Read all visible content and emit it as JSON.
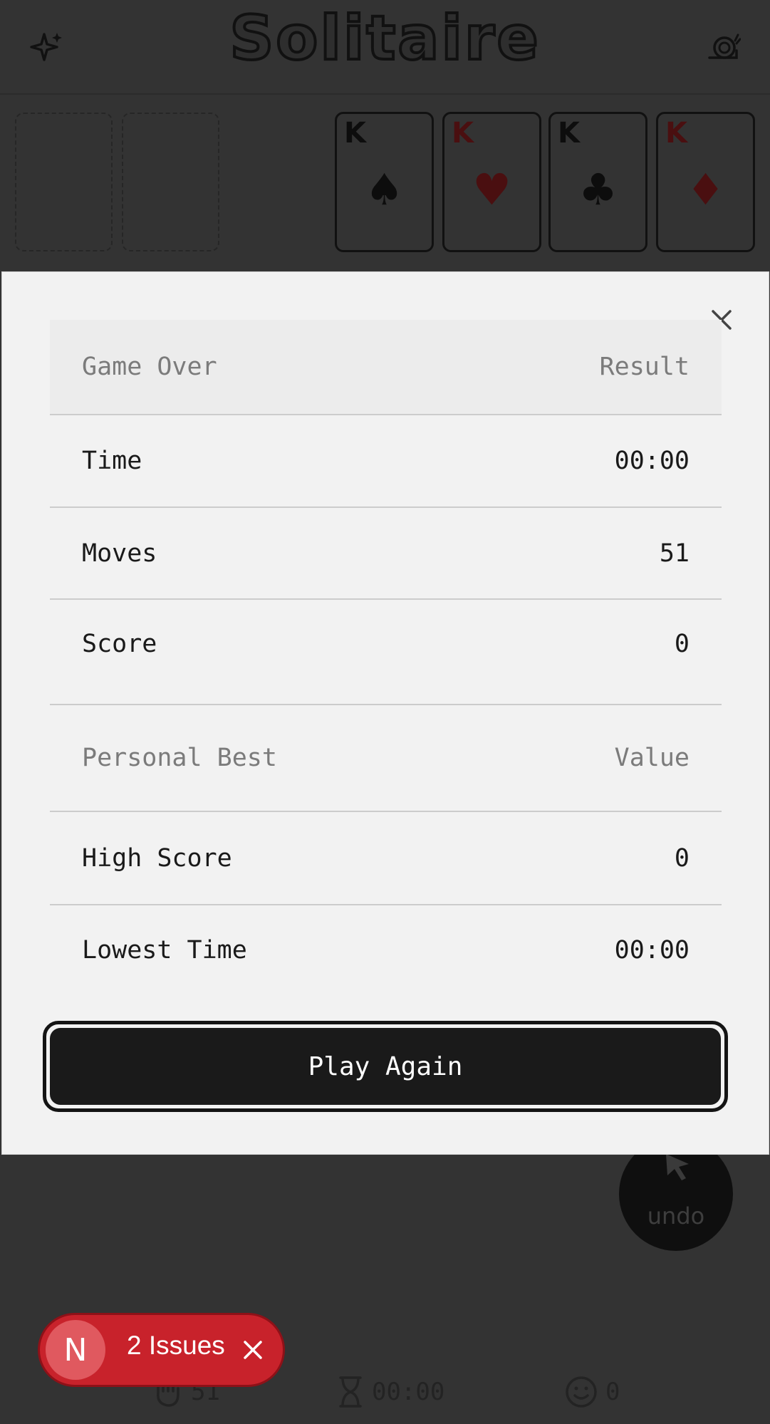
{
  "header": {
    "title": "Solitaire",
    "left_icon": "sparkle-icon",
    "right_icon": "snail-icon"
  },
  "foundations": [
    {
      "rank": "K",
      "suit": "♠",
      "color": "black"
    },
    {
      "rank": "K",
      "suit": "♥",
      "color": "red"
    },
    {
      "rank": "K",
      "suit": "♣",
      "color": "black"
    },
    {
      "rank": "K",
      "suit": "♦",
      "color": "red"
    }
  ],
  "modal": {
    "close_icon": "close-icon",
    "game_over": {
      "header_label": "Game Over",
      "header_value": "Result"
    },
    "stats": [
      {
        "label": "Time",
        "value": "00:00"
      },
      {
        "label": "Moves",
        "value": "51"
      },
      {
        "label": "Score",
        "value": "0"
      }
    ],
    "personal_best": {
      "header_label": "Personal Best",
      "header_value": "Value"
    },
    "best": [
      {
        "label": "High Score",
        "value": "0"
      },
      {
        "label": "Lowest Time",
        "value": "00:00"
      }
    ],
    "play_again_label": "Play Again"
  },
  "undo": {
    "label": "undo",
    "icon": "cursor-icon"
  },
  "footer": {
    "moves": "51",
    "time": "00:00",
    "score": "0"
  },
  "issues_badge": {
    "letter": "N",
    "label": "2 Issues"
  },
  "colors": {
    "background": "#333333",
    "modal": "#f2f2f2",
    "button": "#1a1a1a",
    "badge": "#c8222b",
    "red_suit": "#4a0f10"
  }
}
